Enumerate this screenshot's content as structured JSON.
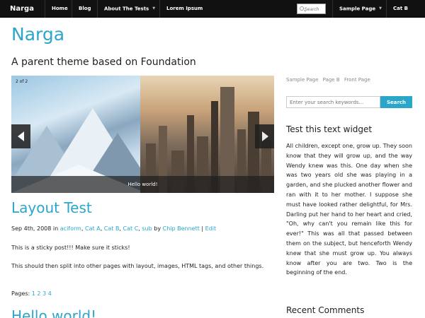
{
  "topbar": {
    "brand": "Narga",
    "nav": [
      "Home",
      "Blog",
      "About The Tests",
      "Lorem Ipsum",
      "Sample Page",
      "Cat B"
    ],
    "search_placeholder": "Search"
  },
  "header": {
    "title": "Narga",
    "tagline": "A parent theme based on Foundation"
  },
  "slider": {
    "counter": "2 of 2",
    "caption": "Hello world!"
  },
  "post": {
    "title": "Layout Test",
    "date": "Sep 4th, 2008",
    "in_label": "in",
    "categories": [
      "aciform",
      "Cat A",
      "Cat B",
      "Cat C",
      "sub"
    ],
    "by_label": "by",
    "author": "Chip Bennett",
    "edit_label": "Edit",
    "sticky_text": "This is a sticky post!!! Make sure it sticks!",
    "body_text": "This should then split into other pages with layout, images, HTML tags, and other things.",
    "pages_label": "Pages:",
    "page_links": [
      "1",
      "2",
      "3",
      "4"
    ],
    "next_title": "Hello world!"
  },
  "sidebar": {
    "links": [
      "Sample Page",
      "Page B",
      "Front Page"
    ],
    "search_placeholder": "Enter your search keywords...",
    "search_button": "Search",
    "widget_title": "Test this text widget",
    "widget_text": "All children, except one, grow up. They soon know that they will grow up, and the way Wendy knew was this. One day when she was two years old she was playing in a garden, and she plucked another flower and ran with it to her mother. I suppose she must have looked rather delightful, for Mrs. Darling put her hand to her heart and cried, \"Oh, why can't you remain like this for ever!\" This was all that passed between them on the subject, but henceforth Wendy knew that she must grow up. You always know after you are two. Two is the beginning of the end.",
    "recent_comments_title": "Recent Comments"
  },
  "colors": {
    "accent": "#2ba6cb",
    "topbar": "#111111"
  }
}
